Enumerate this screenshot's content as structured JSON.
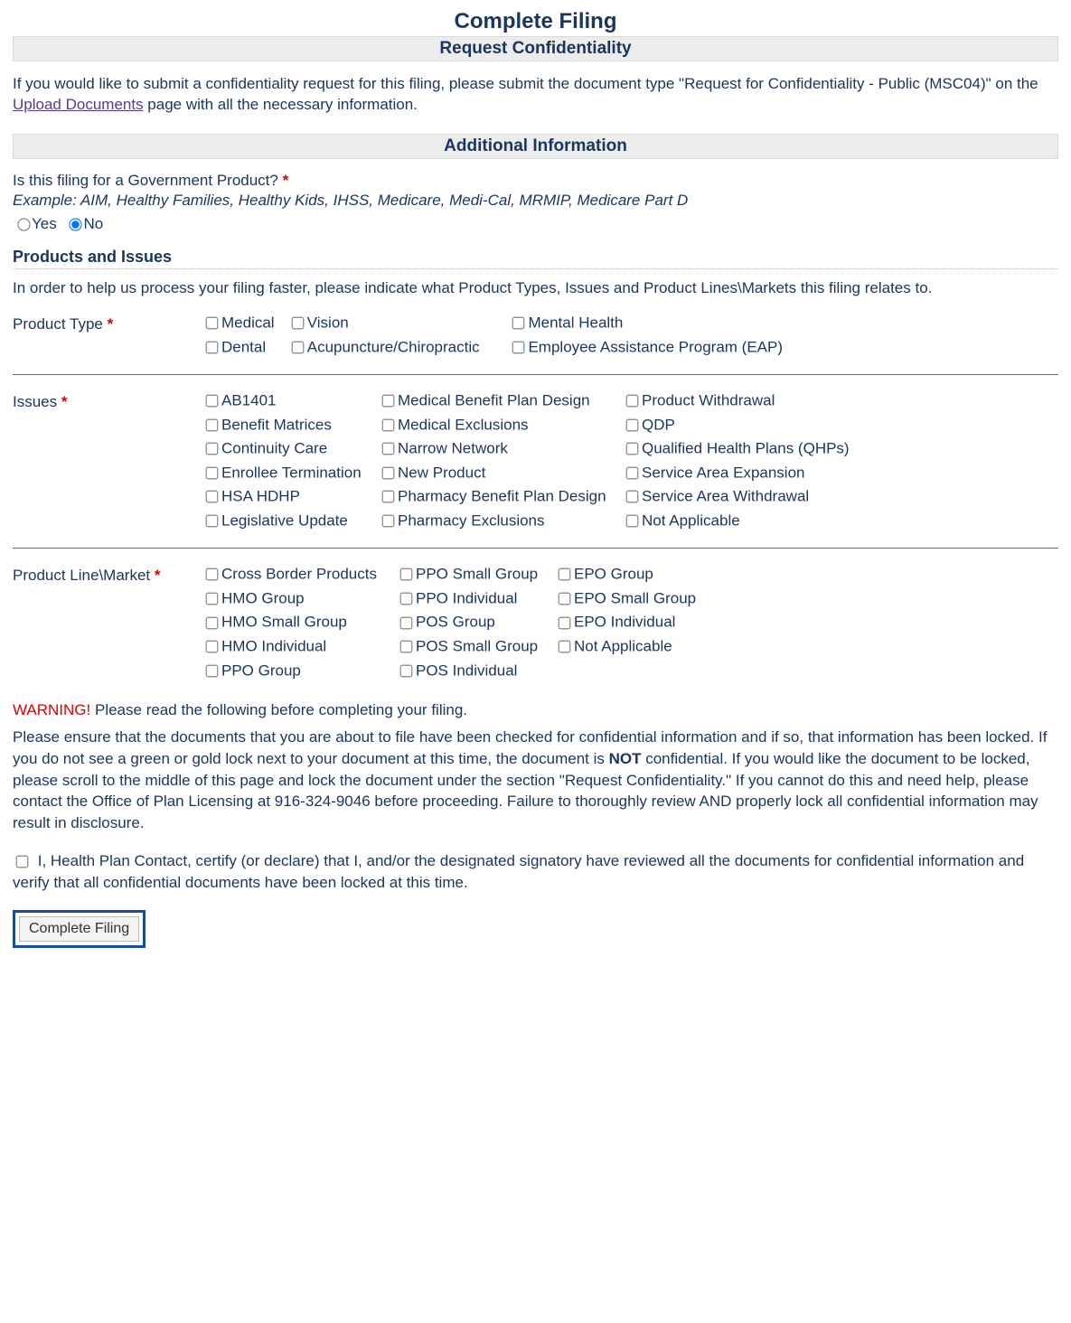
{
  "page_title": "Complete Filing",
  "confidentiality": {
    "heading": "Request Confidentiality",
    "blurb_pre": "If you would like to submit a confidentiality request for this filing, please submit the document type \"Request for Confidentiality - Public (MSC04)\" on the ",
    "link_text": "Upload Documents",
    "blurb_post": " page with all the necessary information."
  },
  "additional": {
    "heading": "Additional Information",
    "gov_question": "Is this filing for a Government Product?",
    "gov_example": "Example: AIM, Healthy Families, Healthy Kids, IHSS, Medicare, Medi-Cal, MRMIP, Medicare Part D",
    "yes_label": "Yes",
    "no_label": "No",
    "gov_selected": "No"
  },
  "products_issues": {
    "heading": "Products and Issues",
    "intro": "In order to help us process your filing faster, please indicate what Product Types, Issues and Product Lines\\Markets this filing relates to.",
    "product_type_label": "Product Type",
    "product_types": {
      "col1": [
        "Medical",
        "Dental"
      ],
      "col2": [
        "Vision",
        "Acupuncture/Chiropractic"
      ],
      "col3": [
        "Mental Health",
        "Employee Assistance Program (EAP)"
      ]
    },
    "issues_label": "Issues",
    "issues": {
      "col1": [
        "AB1401",
        "Benefit Matrices",
        "Continuity Care",
        "Enrollee Termination",
        "HSA HDHP",
        "Legislative Update"
      ],
      "col2": [
        "Medical Benefit Plan Design",
        "Medical Exclusions",
        "Narrow Network",
        "New Product",
        "Pharmacy Benefit Plan Design",
        "Pharmacy Exclusions"
      ],
      "col3": [
        "Product Withdrawal",
        "QDP",
        "Qualified Health Plans (QHPs)",
        "Service Area Expansion",
        "Service Area Withdrawal",
        "Not Applicable"
      ]
    },
    "market_label": "Product Line\\Market",
    "markets": {
      "col1": [
        "Cross Border Products",
        "HMO Group",
        "HMO Small Group",
        "HMO Individual",
        "PPO Group"
      ],
      "col2": [
        "PPO Small Group",
        "PPO Individual",
        "POS Group",
        "POS Small Group",
        "POS Individual"
      ],
      "col3": [
        "EPO Group",
        "EPO Small Group",
        "EPO Individual",
        "Not Applicable"
      ]
    }
  },
  "warning": {
    "label": "WARNING!",
    "tail": " Please read the following before completing your filing.",
    "body_pre": "Please ensure that the documents that you are about to file have been checked for confidential information and if so, that information has been locked. If you do not see a green or gold lock next to your document at this time, the document is ",
    "body_bold": "NOT",
    "body_post": " confidential. If you would like the document to be locked, please scroll to the middle of this page and lock the document under the section \"Request Confidentiality.\" If you cannot do this and need help, please contact the Office of Plan Licensing at 916-324-9046 before proceeding. Failure to thoroughly review AND properly lock all confidential information may result in disclosure."
  },
  "certify": {
    "text": "I, Health Plan Contact, certify (or declare) that I, and/or the designated signatory have reviewed all the documents for confidential information and verify that all confidential documents have been locked at this time."
  },
  "submit_label": "Complete Filing"
}
